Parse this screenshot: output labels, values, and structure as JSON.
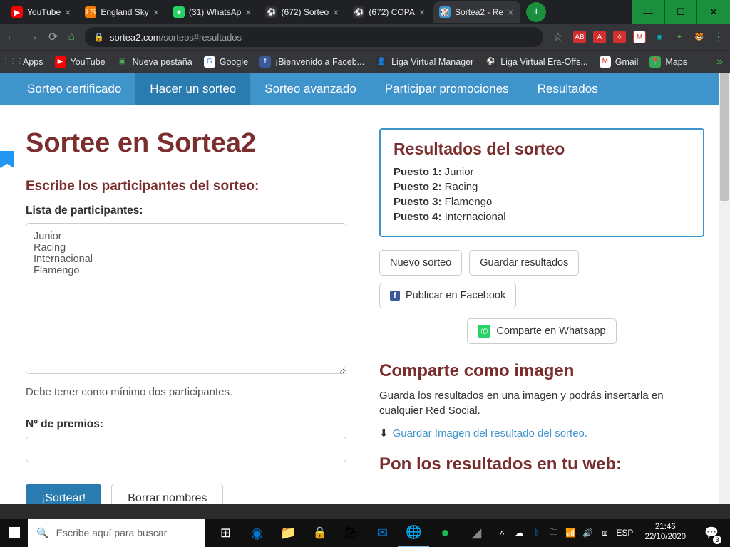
{
  "tabs": [
    {
      "icon": "▶",
      "iconBg": "#f00",
      "title": "YouTube"
    },
    {
      "icon": "LS",
      "iconBg": "#f57c00",
      "title": "England Sky"
    },
    {
      "icon": "●",
      "iconBg": "#25d366",
      "title": "(31) WhatsAp"
    },
    {
      "icon": "⚽",
      "iconBg": "#333",
      "title": "(672) Sorteo"
    },
    {
      "icon": "⚽",
      "iconBg": "#333",
      "title": "(672) COPA"
    },
    {
      "icon": "🎲",
      "iconBg": "#4094cc",
      "title": "Sortea2 - Re"
    }
  ],
  "url": {
    "domain": "sortea2.com",
    "path": "/sorteos#resultados"
  },
  "bookmarks": [
    {
      "label": "Apps",
      "icon": "⋮⋮⋮",
      "color": "#4caf50"
    },
    {
      "label": "YouTube",
      "icon": "▶",
      "iconBg": "#f00"
    },
    {
      "label": "Nueva pestaña",
      "icon": "▣",
      "color": "#4caf50"
    },
    {
      "label": "Google",
      "icon": "G",
      "iconBg": "#fff",
      "iconColor": "#4285f4"
    },
    {
      "label": "¡Bienvenido a Faceb...",
      "icon": "f",
      "iconBg": "#3b5998"
    },
    {
      "label": "Liga Virtual Manager",
      "icon": "👤",
      "iconBg": "#333"
    },
    {
      "label": "Liga Virtual Era-Offs...",
      "icon": "⚽",
      "iconBg": "#333"
    },
    {
      "label": "Gmail",
      "icon": "M",
      "iconBg": "#fff",
      "iconColor": "#d93025"
    },
    {
      "label": "Maps",
      "icon": "📍",
      "iconBg": "#34a853"
    }
  ],
  "siteNav": [
    "Sorteo certificado",
    "Hacer un sorteo",
    "Sorteo avanzado",
    "Participar promociones",
    "Resultados"
  ],
  "siteNavActive": 1,
  "page": {
    "h1": "Sortee en Sortea2",
    "h3": "Escribe los participantes del sorteo:",
    "listLabel": "Lista de participantes:",
    "participants": "Junior\nRacing\nInternacional\nFlamengo",
    "hint": "Debe tener como mínimo dos participantes.",
    "numLabel": "Nº de premios:",
    "sortearBtn": "¡Sortear!",
    "borrarBtn": "Borrar nombres"
  },
  "results": {
    "title": "Resultados del sorteo",
    "items": [
      {
        "pos": "Puesto 1:",
        "name": " Junior"
      },
      {
        "pos": "Puesto 2:",
        "name": " Racing"
      },
      {
        "pos": "Puesto 3:",
        "name": " Flamengo"
      },
      {
        "pos": "Puesto 4:",
        "name": " Internacional"
      }
    ],
    "btnNuevo": "Nuevo sorteo",
    "btnGuardar": "Guardar resultados",
    "btnFacebook": "Publicar en Facebook",
    "btnWhatsapp": "Comparte en Whatsapp"
  },
  "share": {
    "h": "Comparte como imagen",
    "p": " Guarda los resultados en una imagen y podrás insertarla en cualquier Red Social.",
    "link": "Guardar Imagen del resultado del sorteo."
  },
  "web": {
    "h": "Pon los resultados en tu web:"
  },
  "taskbar": {
    "search": "Escribe aquí para buscar",
    "lang": "ESP",
    "time": "21:46",
    "date": "22/10/2020",
    "notifCount": "3"
  }
}
